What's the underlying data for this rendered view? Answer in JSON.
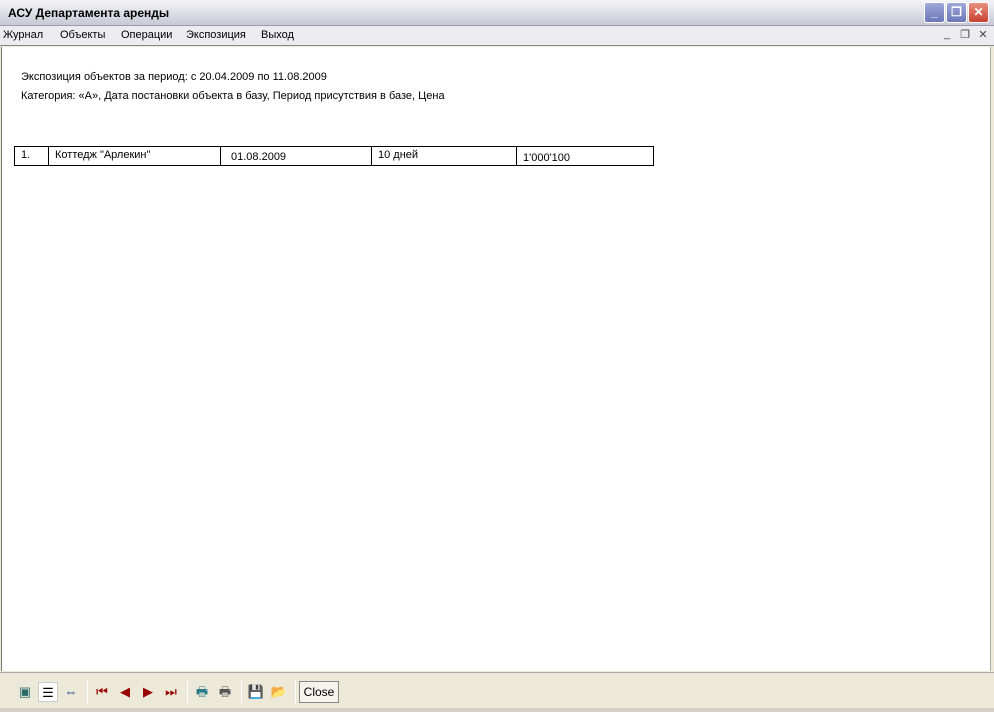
{
  "window": {
    "title": "АСУ Департамента аренды"
  },
  "menu": [
    "Журнал",
    "Объекты",
    "Операции",
    "Экспозиция",
    "Выход"
  ],
  "report": {
    "line1": "Экспозиция объектов за период: с 20.04.2009 по 11.08.2009",
    "line2": "Категория: «А», Дата постановки объекта в базу, Период присутствия в базе, Цена",
    "rows": [
      {
        "num": "1.",
        "name": "Коттедж \"Арлекин\"",
        "date": "01.08.2009",
        "period": "10 дней",
        "price": "1'000'100"
      }
    ]
  },
  "toolbar": {
    "close_label": "Close"
  }
}
